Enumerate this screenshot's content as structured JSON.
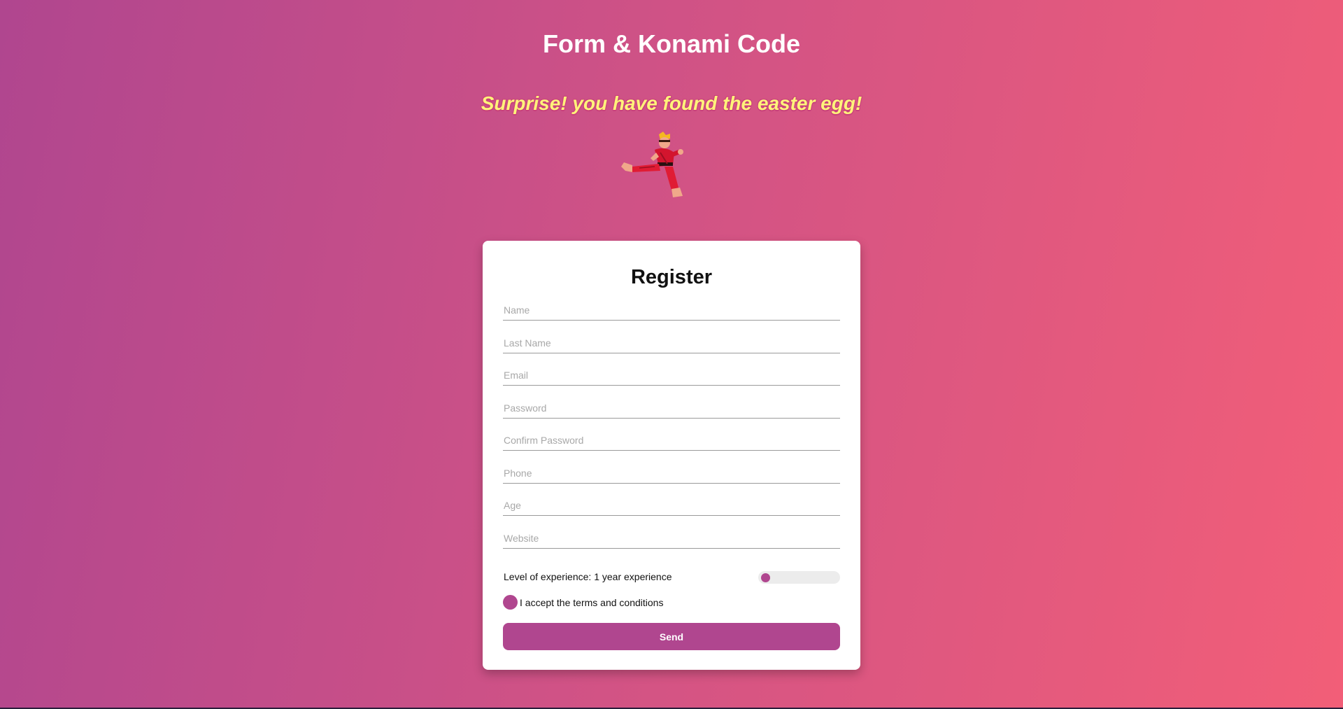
{
  "header": {
    "title": "Form & Konami Code",
    "easter_egg_message": "Surprise! you have found the easter egg!",
    "fighter_image": "karate-fighter-flying-kick"
  },
  "form": {
    "title": "Register",
    "fields": [
      {
        "name": "name",
        "placeholder": "Name",
        "value": ""
      },
      {
        "name": "last-name",
        "placeholder": "Last Name",
        "value": ""
      },
      {
        "name": "email",
        "placeholder": "Email",
        "value": ""
      },
      {
        "name": "password",
        "placeholder": "Password",
        "value": ""
      },
      {
        "name": "confirm-password",
        "placeholder": "Confirm Password",
        "value": ""
      },
      {
        "name": "phone",
        "placeholder": "Phone",
        "value": ""
      },
      {
        "name": "age",
        "placeholder": "Age",
        "value": ""
      },
      {
        "name": "website",
        "placeholder": "Website",
        "value": ""
      }
    ],
    "experience_label": "Level of experience: 1 year experience",
    "experience_level": 0,
    "terms_label": "I accept the terms and conditions",
    "send_label": "Send"
  },
  "colors": {
    "accent": "#b0468f",
    "gradient_start": "#b0468f",
    "gradient_end": "#f25e78",
    "easter_egg_text": "#fff37a"
  }
}
